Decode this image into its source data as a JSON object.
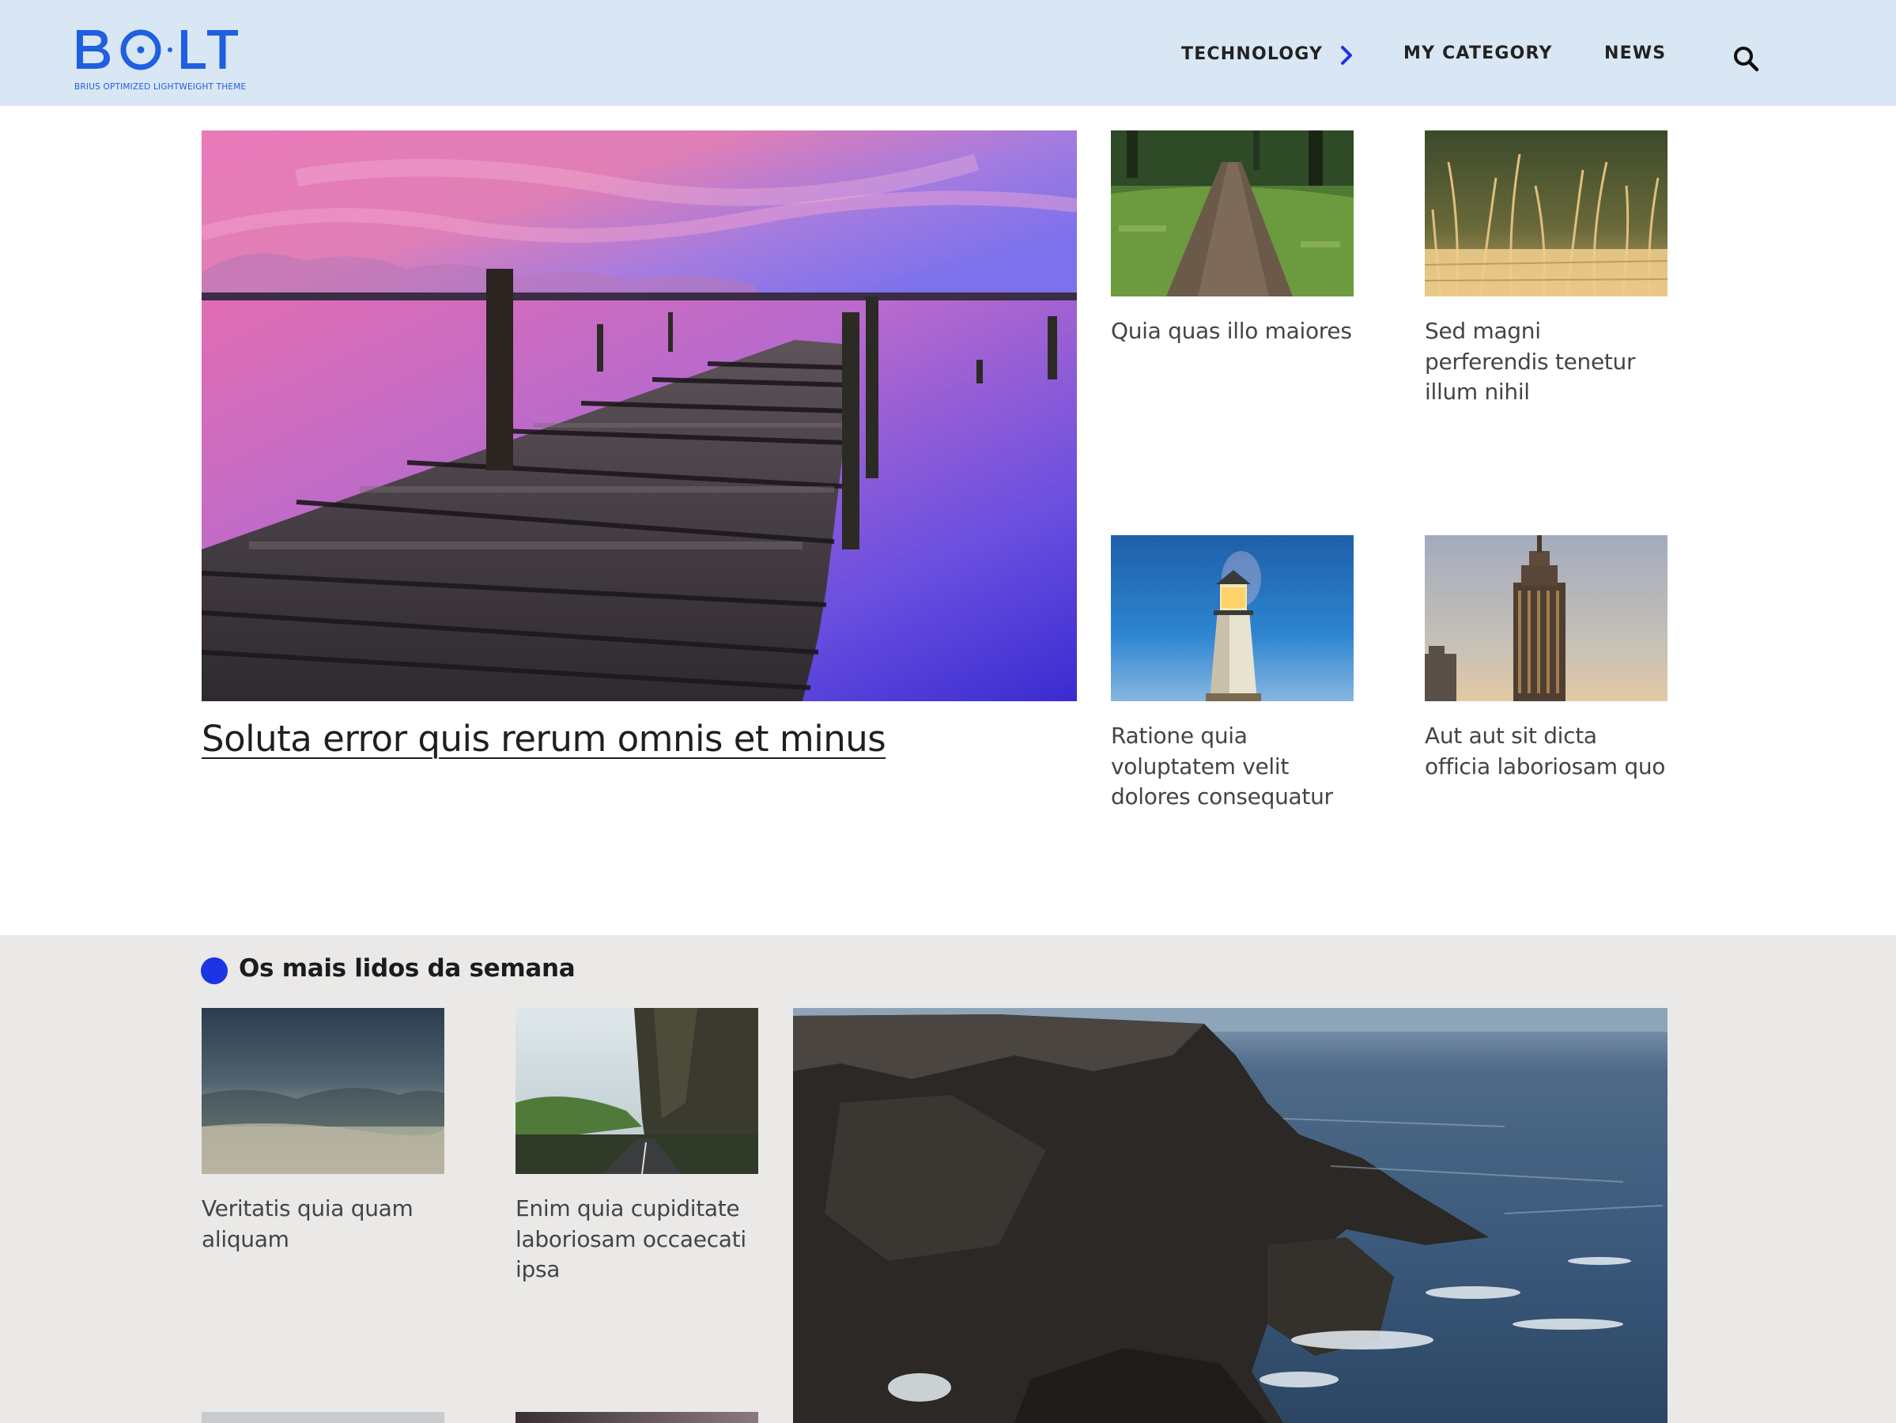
{
  "brand": {
    "logo_text": "BOLT",
    "tagline": "BRIUS OPTIMIZED LIGHTWEIGHT THEME",
    "color": "#1f5fe0"
  },
  "nav": {
    "items": [
      {
        "label": "TECHNOLOGY",
        "icon": "chevron-right-icon"
      },
      {
        "label": "MY CATEGORY"
      },
      {
        "label": "NEWS"
      }
    ],
    "search_icon": "search-icon",
    "accent": "#1d33e6"
  },
  "featured": {
    "main": {
      "title": "Soluta error quis rerum omnis et minus",
      "image": "pier-sunset"
    },
    "cards": [
      {
        "title": "Quia quas illo maiores",
        "image": "forest-path"
      },
      {
        "title": "Sed magni perferendis tenetur illum nihil",
        "image": "wheat-field"
      },
      {
        "title": "Ratione quia voluptatem velit dolores consequatur",
        "image": "lighthouse"
      },
      {
        "title": "Aut aut sit dicta officia laboriosam quo",
        "image": "skyscraper"
      }
    ]
  },
  "most_read": {
    "heading": "Os mais lidos da semana",
    "cards": [
      {
        "title": "Veritatis quia quam aliquam",
        "image": "stormy-sky"
      },
      {
        "title": "Enim quia cupiditate laboriosam occaecati ipsa",
        "image": "cliff-road"
      }
    ],
    "big_image": "sea-cliffs"
  },
  "colors": {
    "header_bg": "#d9e6f3",
    "section_bg": "#eae9e8",
    "dot": "#1d33e6"
  }
}
